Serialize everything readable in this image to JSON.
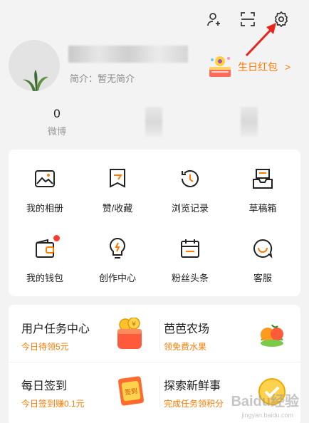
{
  "header": {
    "icons": [
      "add-friend-icon",
      "scan-icon",
      "settings-icon"
    ]
  },
  "profile": {
    "bio": "简介：暂无简介",
    "birthday": {
      "label": "生日红包",
      "chevron": ">"
    }
  },
  "stats": [
    {
      "num": "0",
      "label": "微博"
    }
  ],
  "grid": [
    {
      "label": "我的相册",
      "icon": "album-icon"
    },
    {
      "label": "赞/收藏",
      "icon": "like-favorite-icon"
    },
    {
      "label": "浏览记录",
      "icon": "history-icon"
    },
    {
      "label": "草稿箱",
      "icon": "drafts-icon"
    },
    {
      "label": "我的钱包",
      "icon": "wallet-icon"
    },
    {
      "label": "创作中心",
      "icon": "bulb-icon"
    },
    {
      "label": "粉丝头条",
      "icon": "fans-headline-icon"
    },
    {
      "label": "客服",
      "icon": "customer-service-icon"
    }
  ],
  "tasks": [
    {
      "title": "用户任务中心",
      "sub": "今日待领5元",
      "badge": "¥"
    },
    {
      "title": "芭芭农场",
      "sub": "领免费水果"
    },
    {
      "title": "每日签到",
      "sub": "今日签到赚0.1元",
      "badge": "签到"
    },
    {
      "title": "探索新鲜事",
      "sub": "完成任务领积分"
    }
  ],
  "watermark": {
    "text": "Baidu经验",
    "url": "jingyan.baidu.com"
  },
  "colors": {
    "accent": "#ff7a00",
    "dot": "#ff3b30",
    "arrow": "#e8251c"
  }
}
